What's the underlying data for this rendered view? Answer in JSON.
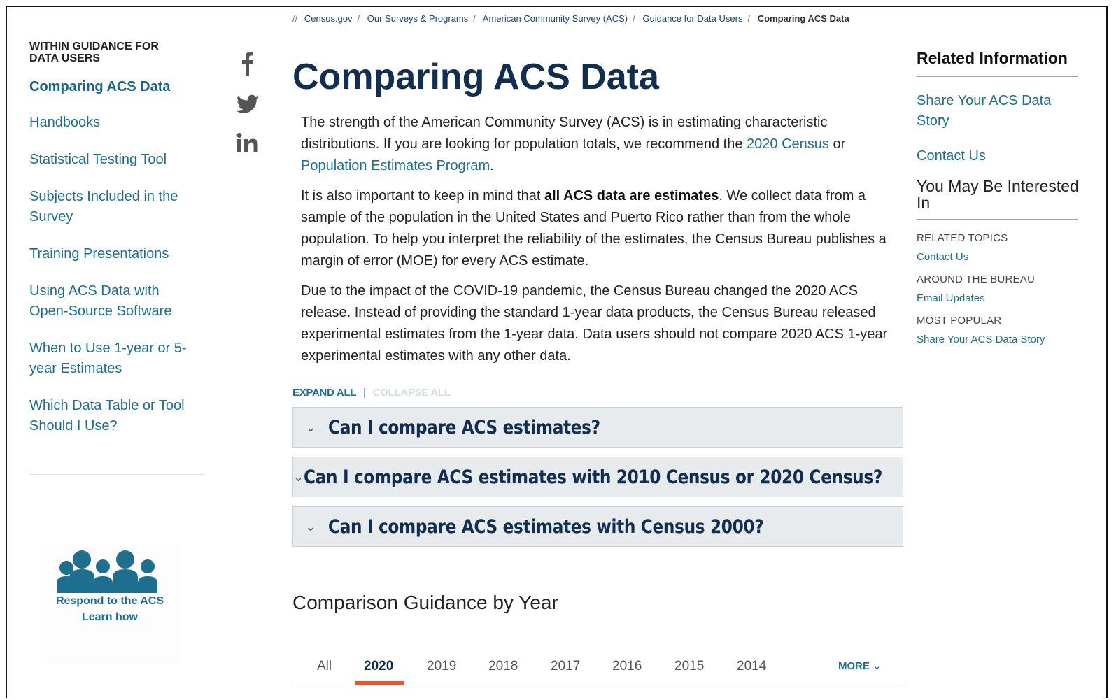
{
  "breadcrumb": {
    "lead": "//",
    "items": [
      "Census.gov",
      "Our Surveys & Programs",
      "American Community Survey (ACS)",
      "Guidance for Data Users"
    ],
    "current": "Comparing ACS Data"
  },
  "leftnav": {
    "heading": "WITHIN GUIDANCE FOR DATA USERS",
    "items": [
      "Comparing ACS Data",
      "Handbooks",
      "Statistical Testing Tool",
      "Subjects Included in the Survey",
      "Training Presentations",
      "Using ACS Data with Open-Source Software",
      "When to Use 1-year or 5-year Estimates",
      "Which Data Table or Tool Should I Use?"
    ]
  },
  "promo": {
    "line1": "Respond to the ACS",
    "line2": "Learn how"
  },
  "social": {
    "icons": [
      "facebook-icon",
      "twitter-icon",
      "linkedin-icon"
    ]
  },
  "main": {
    "title": "Comparing ACS Data",
    "p1": {
      "before": "The strength of the American Community Survey (ACS) is in estimating characteristic distributions. If you are looking for population totals, we recommend the ",
      "link1": "2020 Census",
      "mid": " or ",
      "link2": "Population Estimates Program",
      "after": "."
    },
    "p2": {
      "before": "It is also important to keep in mind that ",
      "bold": "all ACS data are estimates",
      "after": ". We collect data from a sample of the population in the United States and Puerto Rico rather than from the whole population. To help you interpret the reliability of the estimates, the Census Bureau publishes a margin of error (MOE) for every ACS estimate."
    },
    "p3": "Due to the impact of the COVID-19 pandemic, the Census Bureau changed the 2020 ACS release. Instead of providing the standard 1-year data products, the Census Bureau released experimental estimates from the 1-year data. Data users should not compare 2020 ACS 1-year experimental estimates with any other data.",
    "expand_all": "EXPAND ALL",
    "collapse_all": "COLLAPSE ALL",
    "accordions": [
      "Can I compare ACS estimates?",
      "Can I compare ACS estimates with 2010 Census or 2020 Census?",
      "Can I compare ACS estimates with Census 2000?"
    ],
    "section_title": "Comparison Guidance by Year",
    "tabs": [
      "All",
      "2020",
      "2019",
      "2018",
      "2017",
      "2016",
      "2015",
      "2014"
    ],
    "active_tab": "2020",
    "more": "MORE"
  },
  "right": {
    "title": "Related Information",
    "links": [
      "Share Your ACS Data Story",
      "Contact Us"
    ],
    "interest": "You May Be Interested In",
    "groups": [
      {
        "category": "RELATED TOPICS",
        "link": "Contact Us"
      },
      {
        "category": "AROUND THE BUREAU",
        "link": "Email Updates"
      },
      {
        "category": "MOST POPULAR",
        "link": "Share Your ACS Data Story"
      }
    ]
  },
  "colors": {
    "brand_navy": "#112e51",
    "link_teal": "#1d6e8f",
    "active_tab_accent": "#e6552d"
  }
}
